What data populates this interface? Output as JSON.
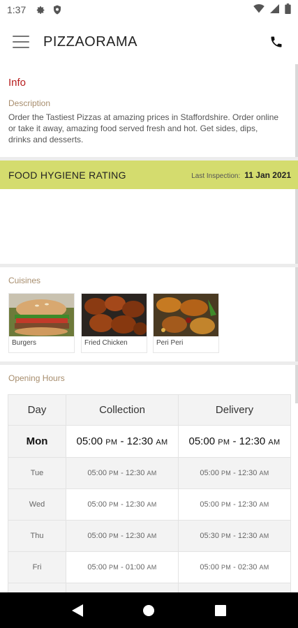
{
  "status_bar": {
    "time": "1:37",
    "icons": [
      "gear-icon",
      "shield-icon",
      "wifi-icon",
      "signal-icon",
      "battery-icon"
    ]
  },
  "app_bar": {
    "menu_icon": "hamburger-menu-icon",
    "title": "PIZZAORAMA",
    "call_icon": "phone-icon"
  },
  "info": {
    "heading": "Info",
    "description_label": "Description",
    "description": "Order the Tastiest Pizzas at amazing prices in Staffordshire. Order online or take it away, amazing food served fresh and hot. Get sides, dips, drinks and desserts."
  },
  "hygiene": {
    "title": "FOOD HYGIENE RATING",
    "last_inspection_label": "Last Inspection:",
    "last_inspection_date": "11 Jan 2021"
  },
  "cuisines": {
    "label": "Cuisines",
    "items": [
      {
        "name": "Burgers"
      },
      {
        "name": "Fried Chicken"
      },
      {
        "name": "Peri Peri"
      }
    ]
  },
  "opening_hours": {
    "label": "Opening Hours",
    "headers": [
      "Day",
      "Collection",
      "Delivery"
    ],
    "rows": [
      {
        "day": "Mon",
        "collection_open": "05:00",
        "collection_open_ampm": "PM",
        "collection_close": "12:30",
        "collection_close_ampm": "AM",
        "delivery_open": "05:00",
        "delivery_open_ampm": "PM",
        "delivery_close": "12:30",
        "delivery_close_ampm": "AM"
      },
      {
        "day": "Tue",
        "collection_open": "05:00",
        "collection_open_ampm": "PM",
        "collection_close": "12:30",
        "collection_close_ampm": "AM",
        "delivery_open": "05:00",
        "delivery_open_ampm": "PM",
        "delivery_close": "12:30",
        "delivery_close_ampm": "AM"
      },
      {
        "day": "Wed",
        "collection_open": "05:00",
        "collection_open_ampm": "PM",
        "collection_close": "12:30",
        "collection_close_ampm": "AM",
        "delivery_open": "05:00",
        "delivery_open_ampm": "PM",
        "delivery_close": "12:30",
        "delivery_close_ampm": "AM"
      },
      {
        "day": "Thu",
        "collection_open": "05:00",
        "collection_open_ampm": "PM",
        "collection_close": "12:30",
        "collection_close_ampm": "AM",
        "delivery_open": "05:30",
        "delivery_open_ampm": "PM",
        "delivery_close": "12:30",
        "delivery_close_ampm": "AM"
      },
      {
        "day": "Fri",
        "collection_open": "05:00",
        "collection_open_ampm": "PM",
        "collection_close": "01:00",
        "collection_close_ampm": "AM",
        "delivery_open": "05:00",
        "delivery_open_ampm": "PM",
        "delivery_close": "02:30",
        "delivery_close_ampm": "AM"
      }
    ]
  },
  "nav_bar": {
    "icons": [
      "back-icon",
      "home-icon",
      "recents-icon"
    ]
  },
  "colors": {
    "info_heading": "#b71c1c",
    "label_tan": "#a78d6d",
    "hygiene_band": "#d4dc6e",
    "nav_bar": "#000000"
  }
}
